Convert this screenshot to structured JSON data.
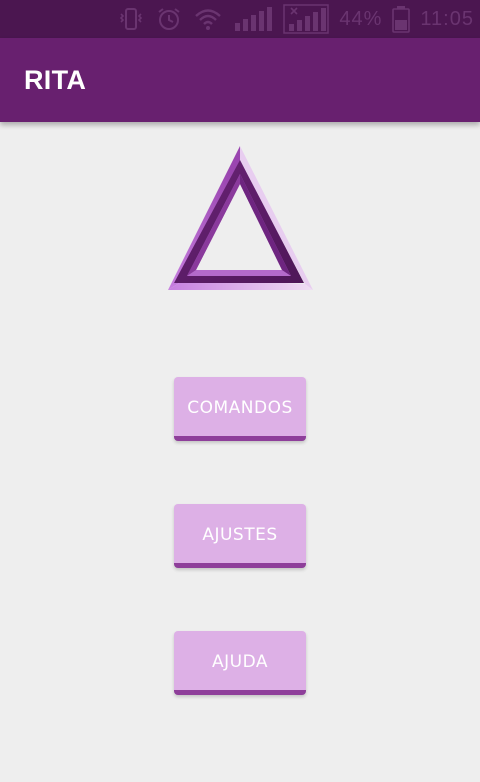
{
  "status_bar": {
    "battery": "44%",
    "time": "11:05"
  },
  "app_bar": {
    "title": "RITA"
  },
  "logo": {
    "icon": "triangle-logo-icon",
    "colors": {
      "dark": "#5a1a63",
      "mid": "#9a45b0",
      "light": "#c77fe0",
      "pale": "#e8cdf0"
    }
  },
  "menu": {
    "buttons": [
      {
        "label": "COMANDOS"
      },
      {
        "label": "AJUSTES"
      },
      {
        "label": "AJUDA"
      }
    ]
  },
  "colors": {
    "status_bar": "#4b1650",
    "app_bar": "#68206f",
    "background": "#eeeeee",
    "button": "#ddb0e6",
    "button_shadow": "#8e3e9a"
  }
}
